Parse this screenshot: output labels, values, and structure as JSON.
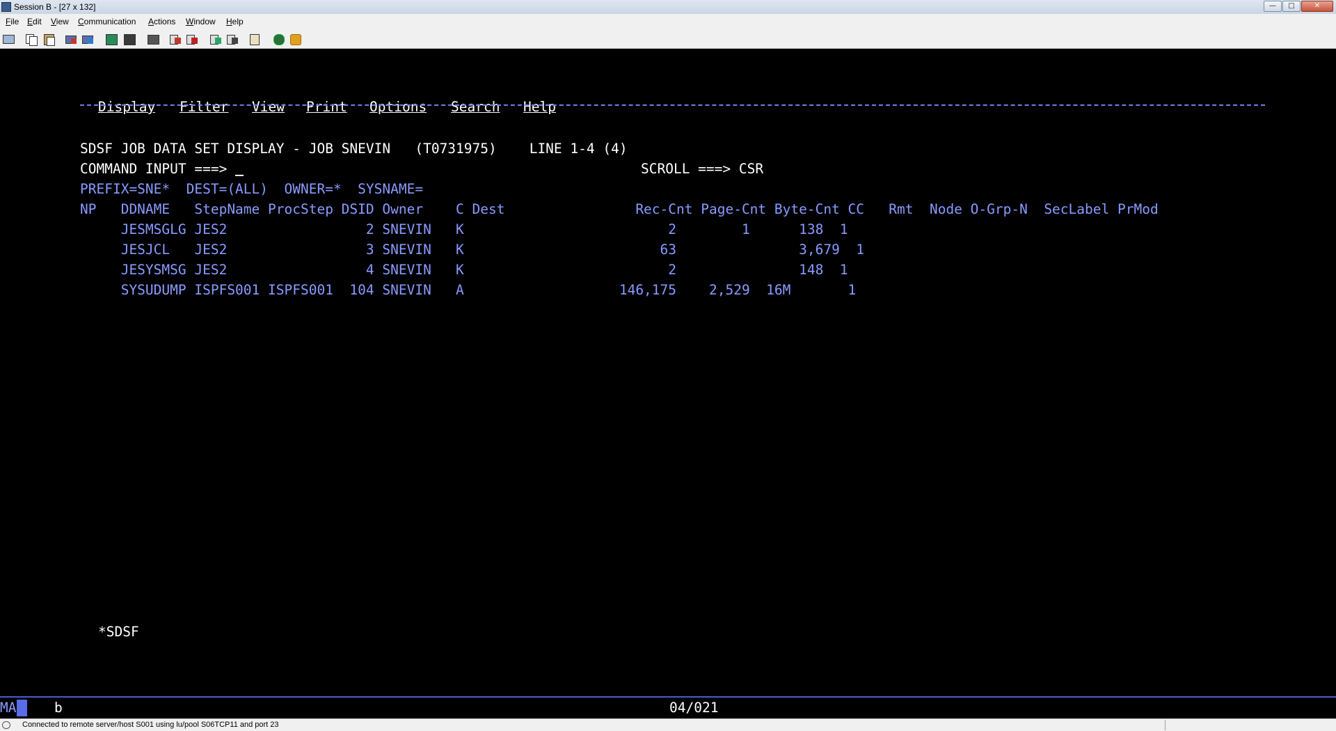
{
  "window": {
    "title": "Session B - [27 x 132]"
  },
  "menubar": [
    "File",
    "Edit",
    "View",
    "Communication",
    "Actions",
    "Window",
    "Help"
  ],
  "toolbar_icons": [
    "print-screen-icon",
    "copy-icon",
    "paste-icon",
    "send-icon",
    "receive-icon",
    "display-icon",
    "keypad-icon",
    "macro-icon",
    "record-macro-icon",
    "stop-macro-icon",
    "play-macro-icon",
    "transfer-icon",
    "settings-icon",
    "globe-icon",
    "help-icon"
  ],
  "terminal": {
    "action_bar": [
      "Display",
      "Filter",
      "View",
      "Print",
      "Options",
      "Search",
      "Help"
    ],
    "title_line": "SDSF JOB DATA SET DISPLAY - JOB SNEVIN   (T0731975)    LINE 1-4 (4)",
    "command_label": "COMMAND INPUT ===> ",
    "scroll_label": "SCROLL ===> CSR",
    "filter_line": "PREFIX=SNE*  DEST=(ALL)  OWNER=*  SYSNAME=",
    "header": "NP   DDNAME   StepName ProcStep DSID Owner    C Dest                Rec-Cnt Page-Cnt Byte-Cnt CC   Rmt  Node O-Grp-N  SecLabel PrMod",
    "rows": [
      "     JESMSGLG JES2                 2 SNEVIN   K                         2        1      138  1",
      "     JESJCL   JES2                 3 SNEVIN   K                        63               3,679  1",
      "     JESYSMSG JES2                 4 SNEVIN   K                         2               148  1",
      "     SYSUDUMP ISPFS001 ISPFS001  104 SNEVIN   A                   146,175    2,529  16M       1"
    ],
    "footer_tag": "*SDSF"
  },
  "oia": {
    "indicator": "MA",
    "mode": "b",
    "position": "04/021"
  },
  "statusbar": {
    "text": "Connected to remote server/host S001 using lu/pool S06TCP11 and port 23"
  }
}
